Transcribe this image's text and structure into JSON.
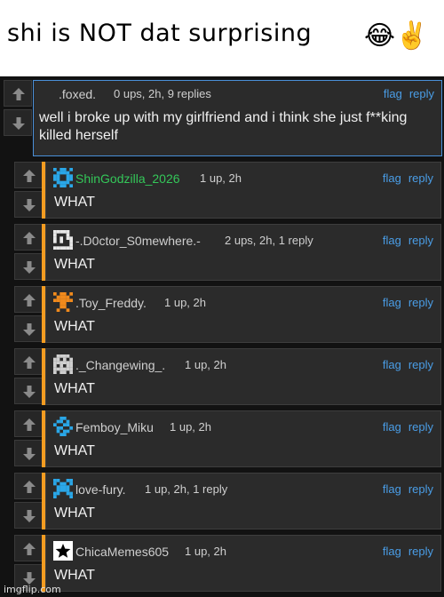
{
  "caption": {
    "text": "shi is NOT dat surprising",
    "emoji": "😂✌️"
  },
  "colors": {
    "reply_bar": "#f39c21",
    "link": "#4a9de6",
    "highlight_border": "#4a90d9",
    "username_green": "#34c759"
  },
  "top_comment": {
    "username": ".foxed.",
    "meta": "0 ups, 2h, 9 replies",
    "flag": "flag",
    "reply": "reply",
    "text": "well i broke up with my girlfriend and i think she just f**king killed herself"
  },
  "replies": [
    {
      "username": "ShinGodzilla_2026",
      "meta": "1 up, 2h",
      "text": "WHAT",
      "avatar": "blue-pixel-icon",
      "flag": "flag",
      "reply": "reply"
    },
    {
      "username": "-.D0ctor_S0mewhere.-",
      "meta": "2 ups, 2h, 1 reply",
      "text": "WHAT",
      "avatar": "white-pixel-icon",
      "flag": "flag",
      "reply": "reply"
    },
    {
      "username": ".Toy_Freddy.",
      "meta": "1 up, 2h",
      "text": "WHAT",
      "avatar": "orange-pixel-icon",
      "flag": "flag",
      "reply": "reply"
    },
    {
      "username": "._Changewing_.",
      "meta": "1 up, 2h",
      "text": "WHAT",
      "avatar": "grey-pixel-icon",
      "flag": "flag",
      "reply": "reply"
    },
    {
      "username": "Femboy_Miku",
      "meta": "1 up, 2h",
      "text": "WHAT",
      "avatar": "blue-pixel-icon",
      "flag": "flag",
      "reply": "reply"
    },
    {
      "username": "love-fury.",
      "meta": "1 up, 2h, 1 reply",
      "text": "WHAT",
      "avatar": "blue-pixel-icon",
      "flag": "flag",
      "reply": "reply"
    },
    {
      "username": "ChicaMemes605",
      "meta": "1 up, 2h",
      "text": "WHAT",
      "avatar": "star-icon",
      "flag": "flag",
      "reply": "reply"
    }
  ],
  "watermark": "imgflip.com"
}
